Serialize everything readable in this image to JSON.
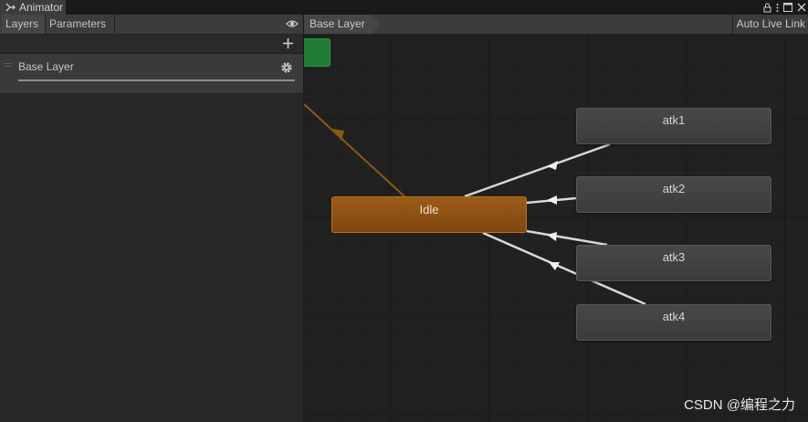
{
  "window": {
    "title": "Animator"
  },
  "left_panel": {
    "tabs": {
      "layers": "Layers",
      "parameters": "Parameters"
    },
    "layers": [
      {
        "name": "Base Layer"
      }
    ]
  },
  "graph": {
    "breadcrumb": "Base Layer",
    "auto_live_link": "Auto Live Link",
    "states": {
      "idle": "Idle",
      "atk1": "atk1",
      "atk2": "atk2",
      "atk3": "atk3",
      "atk4": "atk4"
    },
    "colors": {
      "default_state": "#8a4e13",
      "entry": "#1f7a33",
      "state": "#414244",
      "transition": "#d8d8d8",
      "default_transition": "#8a5a12"
    }
  },
  "watermark": "CSDN @编程之力"
}
